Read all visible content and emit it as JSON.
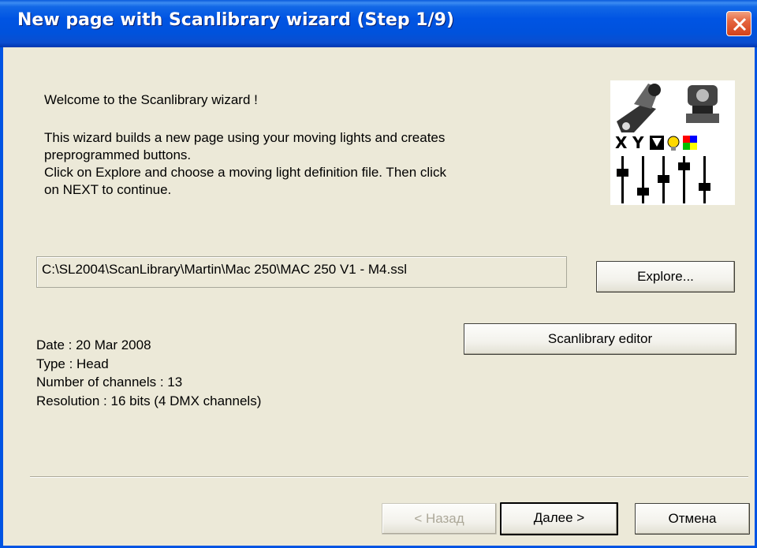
{
  "window": {
    "title": "New page with Scanlibrary wizard (Step 1/9)"
  },
  "intro": {
    "welcome": "Welcome to the Scanlibrary wizard !",
    "lines": [
      "This wizard builds a new page using your moving lights and creates",
      "preprogrammed buttons.",
      "Click on Explore and choose a moving light definition file. Then click",
      "on NEXT to continue."
    ]
  },
  "file": {
    "path": "C:\\SL2004\\ScanLibrary\\Martin\\Mac 250\\MAC 250 V1 - M4.ssl"
  },
  "buttons": {
    "explore": "Explore...",
    "editor": "Scanlibrary editor",
    "back": "< Назад",
    "next": "Далее >",
    "cancel": "Отмена"
  },
  "info": {
    "date": "Date : 20 Mar 2008",
    "type": "Type : Head",
    "channels": "Number of channels : 13",
    "resolution": "Resolution : 16 bits (4 DMX channels)"
  },
  "logo": {
    "label_x": "X",
    "label_y": "Y"
  },
  "colors": {
    "titlebar": "#0054e3",
    "dialog_bg": "#ece9d8",
    "close_button": "#e5653f"
  }
}
